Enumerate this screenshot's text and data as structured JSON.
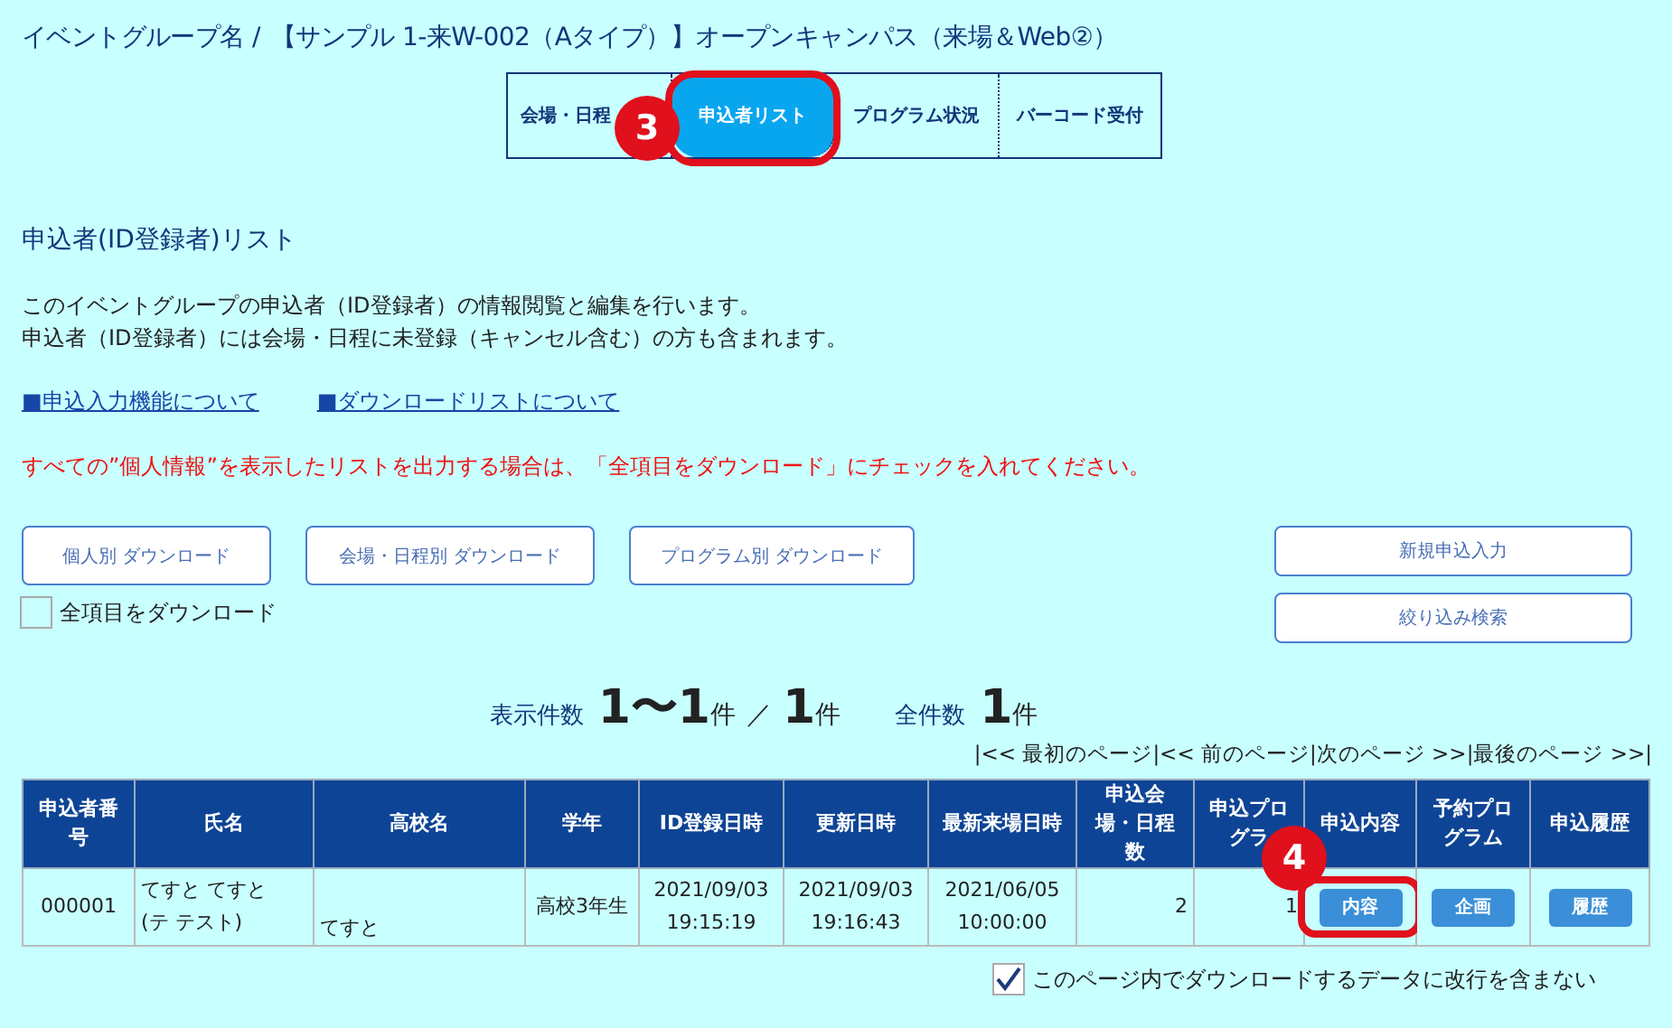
{
  "breadcrumb": {
    "label": "イベントグループ名 /",
    "title": "【サンプル 1-来W-002（Aタイプ）】オープンキャンパス（来場＆Web②）"
  },
  "tabs": [
    {
      "label": "会場・日程",
      "selected": false
    },
    {
      "label": "申込者リスト",
      "selected": true,
      "callout": "3"
    },
    {
      "label": "プログラム状況",
      "selected": false
    },
    {
      "label": "バーコード受付",
      "selected": false
    }
  ],
  "section_title": "申込者(ID登録者)リスト",
  "description": [
    "このイベントグループの申込者（ID登録者）の情報閲覧と編集を行います。",
    "申込者（ID登録者）には会場・日程に未登録（キャンセル含む）の方も含まれます。"
  ],
  "links": [
    "■申込入力機能について",
    "■ダウンロードリストについて"
  ],
  "notice": "すべての”個人情報”を表示したリストを出力する場合は、「全項目をダウンロード」にチェックを入れてください。",
  "download_buttons": [
    "個人別 ダウンロード",
    "会場・日程別 ダウンロード",
    "プログラム別 ダウンロード"
  ],
  "download_all": {
    "label": "全項目をダウンロード",
    "checked": false
  },
  "action_buttons": [
    "新規申込入力",
    "絞り込み検索"
  ],
  "counts": {
    "shown_label": "表示件数",
    "shown_from": "1",
    "range_sep": "〜",
    "shown_to": "1",
    "unit1": "件",
    "slash": "／",
    "total_shown": "1",
    "unit2": "件",
    "total_label": "全件数",
    "total": "1",
    "unit3": "件"
  },
  "pagination": [
    "|<< 最初のページ",
    "|<< 前のページ",
    "|次のページ >>",
    "|最後のページ >>|"
  ],
  "table": {
    "columns": [
      "申込者番号",
      "氏名",
      "高校名",
      "学年",
      "ID登録日時",
      "更新日時",
      "最新来場日時",
      "申込会場・日程数",
      "申込プログラ",
      "申込内容",
      "予約プログラム",
      "申込履歴"
    ],
    "rows": [
      {
        "cells": [
          "000001",
          "てすと てすと\n(テ テスト)",
          "てすと",
          "高校3年生",
          "2021/09/03\n19:15:19",
          "2021/09/03\n19:16:43",
          "2021/06/05\n10:00:00",
          "2",
          "1"
        ],
        "buttons": [
          {
            "label": "内容",
            "callout": "4"
          },
          {
            "label": "企画"
          },
          {
            "label": "履歴"
          }
        ]
      }
    ]
  },
  "no_linebreak": {
    "label": "このページ内でダウンロードするデータに改行を含まない",
    "checked": true
  }
}
